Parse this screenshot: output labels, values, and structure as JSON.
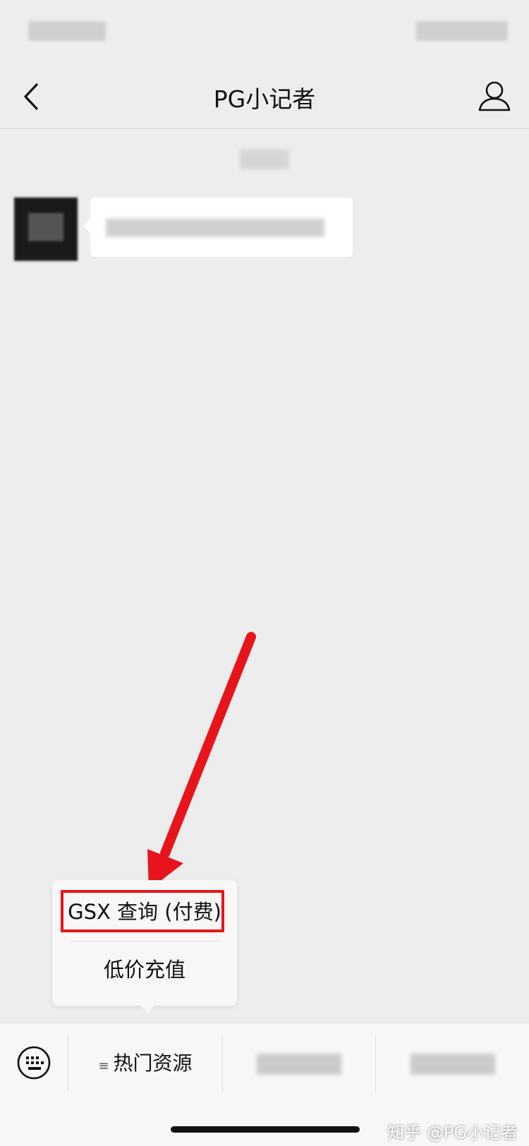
{
  "app": {
    "nav_title": "PG小记者"
  },
  "popup_menu": {
    "items": [
      {
        "label": "GSX 查询 (付费)",
        "highlighted": true
      },
      {
        "label": "低价充值",
        "highlighted": false
      }
    ]
  },
  "bottom_menu": {
    "tabs": [
      {
        "label": "热门资源",
        "icon": "menu-lines-icon",
        "visible_text": true
      },
      {
        "label": "",
        "visible_text": false
      },
      {
        "label": "",
        "visible_text": false
      }
    ]
  },
  "watermark": "知乎 @PG小记者",
  "colors": {
    "background": "#ededed",
    "annotation_red": "#e8141b",
    "bubble_white": "#ffffff"
  }
}
